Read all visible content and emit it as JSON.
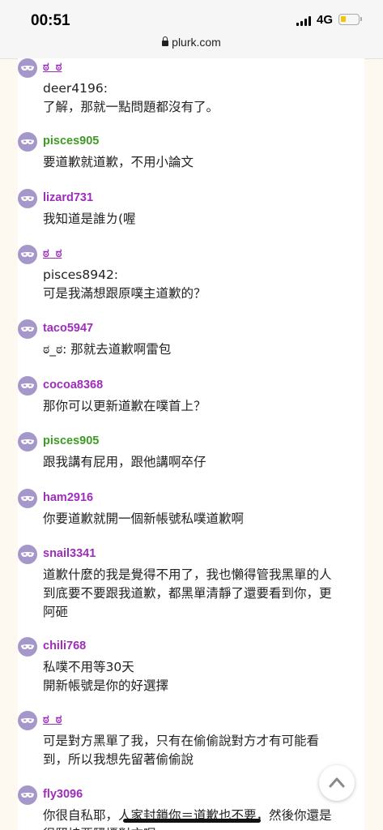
{
  "status_bar": {
    "time": "00:51",
    "network": "4G",
    "url": "plurk.com"
  },
  "responses": [
    {
      "name": "ಠ_ಠ",
      "color": "#9e2dbb",
      "text": "deer4196:\n了解，那就一點問題都沒有了。"
    },
    {
      "name": "pisces905",
      "color": "#3f9a25",
      "text": "要道歉就道歉，不用小論文"
    },
    {
      "name": "lizard731",
      "color": "#9e2dbb",
      "text": "我知道是誰ㄌ(喔"
    },
    {
      "name": "ಠ_ಠ",
      "color": "#9e2dbb",
      "text": "pisces8942:\n可是我滿想跟原噗主道歉的？"
    },
    {
      "name": "taco5947",
      "color": "#9e2dbb",
      "text": "ಠ_ಠ: 那就去道歉啊雷包"
    },
    {
      "name": "cocoa8368",
      "color": "#9e2dbb",
      "text": "那你可以更新道歉在噗首上？"
    },
    {
      "name": "pisces905",
      "color": "#3f9a25",
      "text": "跟我講有屁用，跟他講啊卒仔"
    },
    {
      "name": "ham2916",
      "color": "#9e2dbb",
      "text": "你要道歉就開一個新帳號私噗道歉啊"
    },
    {
      "name": "snail3341",
      "color": "#9e2dbb",
      "text": "道歉什麼的我是覺得不用了，我也懶得管我黑單的人到底要不要跟我道歉，都黑單清靜了還要看到你，更阿砸"
    },
    {
      "name": "chili768",
      "color": "#9e2dbb",
      "text": "私噗不用等30天\n開新帳號是你的好選擇"
    },
    {
      "name": "ಠ_ಠ",
      "color": "#9e2dbb",
      "text": "可是對方黑單了我，只有在偷偷說對方才有可能看到，所以我想先留著偷偷說"
    },
    {
      "name": "fly3096",
      "color": "#9e2dbb",
      "text": "你很自私耶，人家封鎖你＝道歉也不要，然後你還是很堅持要騷擾對方喔"
    }
  ],
  "icons": {
    "avatar": "anonymous-mask-icon",
    "scroll_top": "chevron-up-icon",
    "lock": "lock-icon"
  }
}
